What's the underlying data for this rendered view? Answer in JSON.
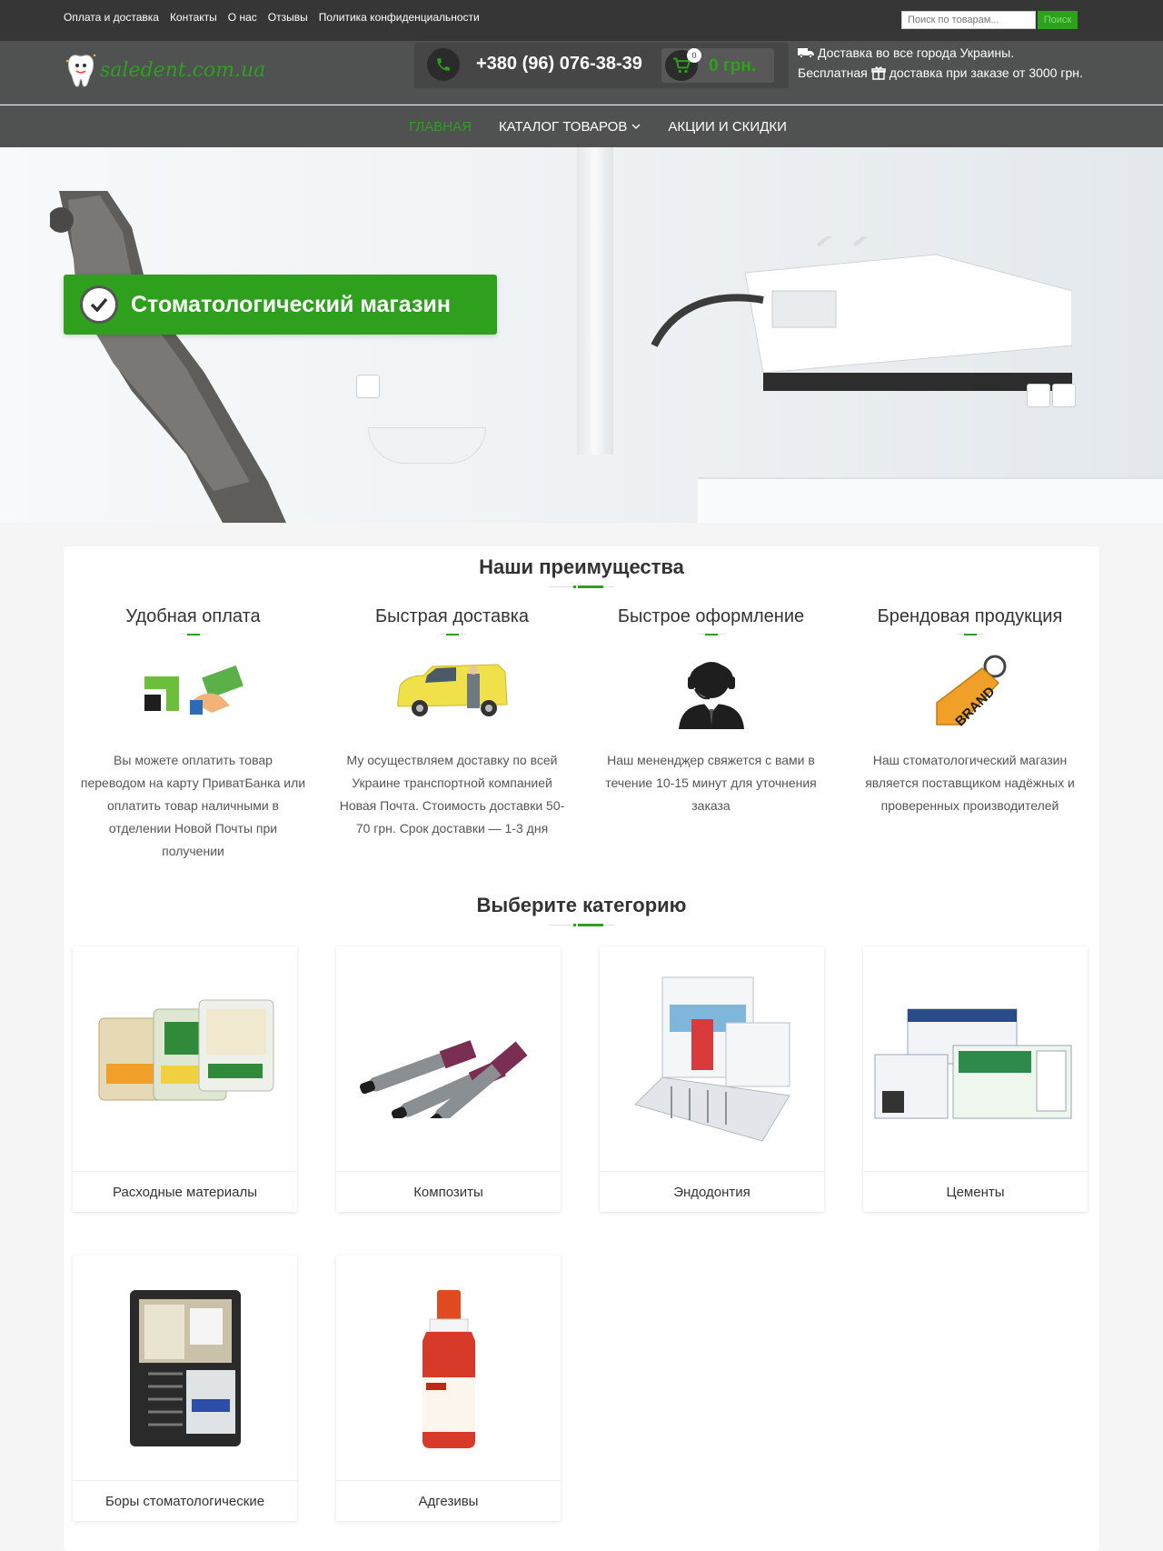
{
  "topnav": {
    "links": [
      "Оплата и доставка",
      "Контакты",
      "О нас",
      "Отзывы",
      "Политика конфиденциальности"
    ]
  },
  "search": {
    "placeholder": "Поиск по товарам...",
    "button": "Поиск"
  },
  "header": {
    "logo_text": "saledent.com.ua",
    "phone": "+380 (96) 076-38-39",
    "cart_count": "0",
    "cart_total": "0 грн.",
    "delivery_line1": "Доставка во все города Украины.",
    "delivery_line2_a": "Бесплатная",
    "delivery_line2_b": "доставка при заказе от 3000 грн."
  },
  "mainnav": {
    "items": [
      "ГЛАВНАЯ",
      "КАТАЛОГ ТОВАРОВ",
      "АКЦИИ И СКИДКИ"
    ]
  },
  "hero": {
    "title": "Стоматологический магазин"
  },
  "advantages": {
    "title": "Наши преимущества",
    "items": [
      {
        "title": "Удобная оплата",
        "text": "Вы можете оплатить товар переводом на карту ПриватБанка или оплатить товар наличными в отделении Новой Почты при получении"
      },
      {
        "title": "Быстрая доставка",
        "text": "Му осуществляем доставку по всей Украине транспортной компанией Новая Почта. Стоимость доставки 50-70 грн. Срок доставки — 1-3 дня"
      },
      {
        "title": "Быстрое оформление",
        "text": "Наш менендҗер свяжется с вами в течение 10-15 минут для уточнения заказа"
      },
      {
        "title": "Брендовая продукция",
        "text": "Наш стоматологический магазин является поставщиком надёжных и проверенных производителей"
      }
    ]
  },
  "categories": {
    "title": "Выберите категорию",
    "items": [
      "Расходные материалы",
      "Композиты",
      "Эндодонтия",
      "Цементы",
      "Боры стоматологические",
      "Адгезивы"
    ]
  },
  "colors": {
    "accent": "#2ea01e",
    "dark_bar": "#3a3a3a"
  }
}
